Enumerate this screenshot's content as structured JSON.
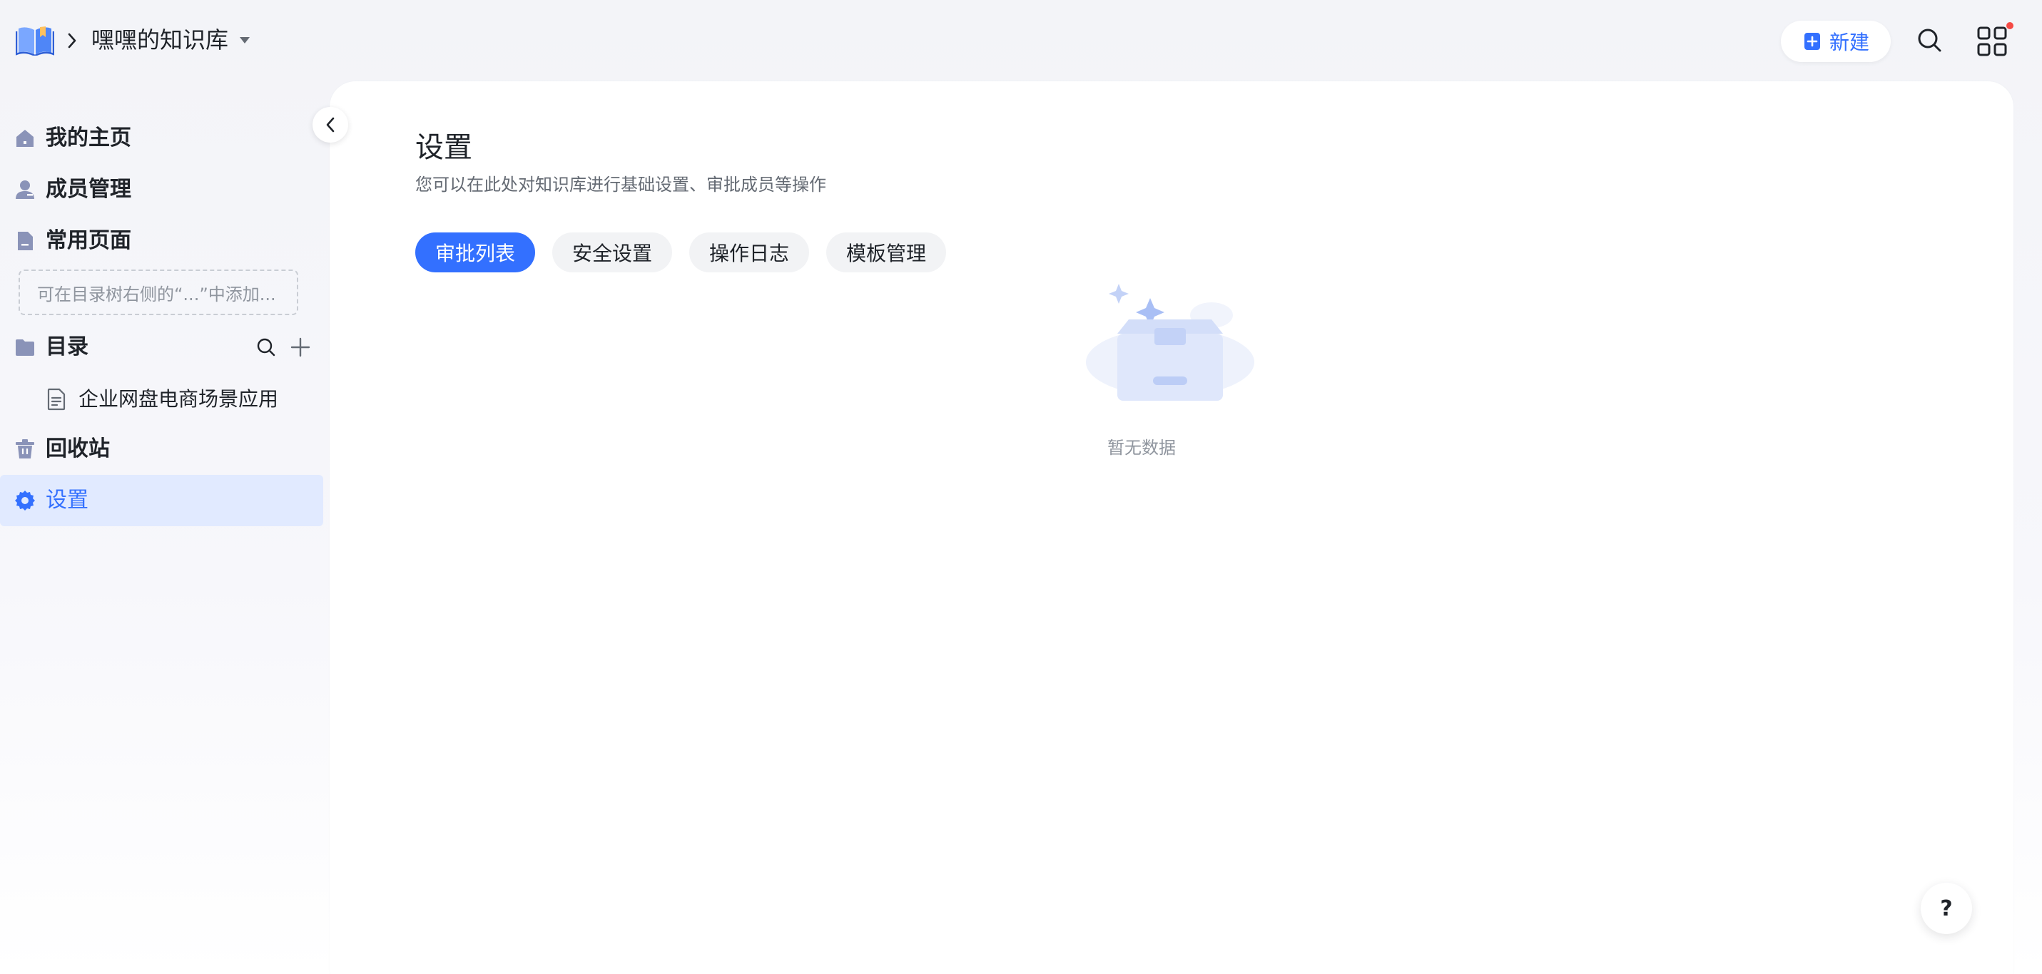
{
  "header": {
    "logo_icon": "book-logo-icon",
    "breadcrumb_icon": "chevron-right-icon",
    "knowledge_base_name": "嘿嘿的知识库",
    "dropdown_icon": "caret-down-icon",
    "new_button_label": "新建",
    "new_button_icon": "plus-document-icon",
    "search_icon": "search-icon",
    "apps_icon": "apps-grid-icon",
    "notification_dot_color": "#f54a45"
  },
  "sidebar": {
    "home_label": "我的主页",
    "members_label": "成员管理",
    "frequent_label": "常用页面",
    "frequent_placeholder": "可在目录树右侧的“...”中添加...",
    "directory_label": "目录",
    "directory_doc": "企业网盘电商场景应用",
    "recycle_label": "回收站",
    "settings_label": "设置",
    "active_item": "设置",
    "collapse_icon": "chevron-left-icon"
  },
  "main": {
    "title": "设置",
    "description": "您可以在此处对知识库进行基础设置、审批成员等操作",
    "tabs": [
      {
        "label": "审批列表",
        "active": true
      },
      {
        "label": "安全设置",
        "active": false
      },
      {
        "label": "操作日志",
        "active": false
      },
      {
        "label": "模板管理",
        "active": false
      }
    ],
    "empty_text": "暂无数据",
    "empty_icon": "empty-box-icon"
  },
  "help_label": "?",
  "colors": {
    "accent": "#3370ff",
    "active_bg": "#e1eaff",
    "sidebar_icon": "#8a93b8"
  }
}
